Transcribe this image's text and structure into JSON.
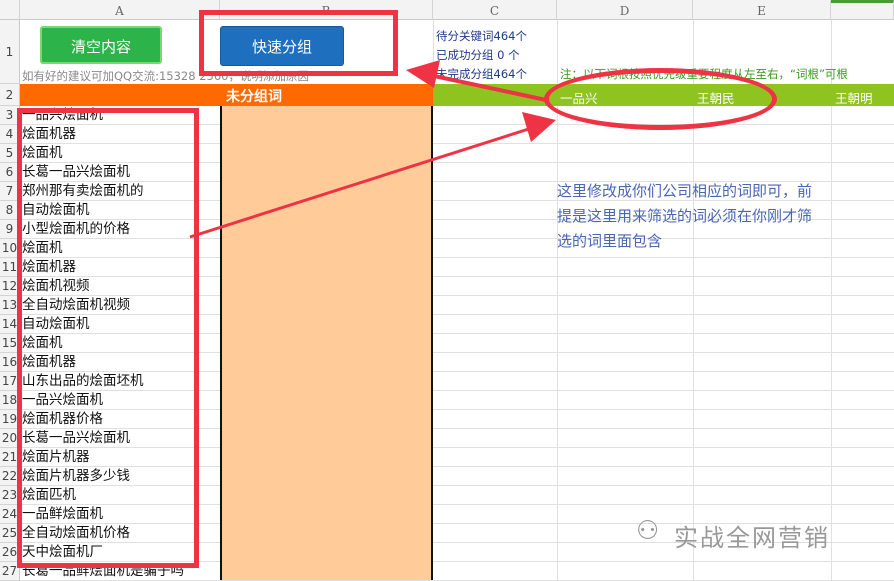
{
  "columns": [
    "A",
    "B",
    "C",
    "D",
    "E"
  ],
  "rows": [
    "1",
    "2",
    "3",
    "4",
    "5",
    "6",
    "7",
    "8",
    "9",
    "10",
    "11",
    "12",
    "13",
    "14",
    "15",
    "16",
    "17",
    "18",
    "19",
    "20",
    "21",
    "22",
    "23",
    "24",
    "25",
    "26",
    "27"
  ],
  "buttons": {
    "clear": "清空内容",
    "group": "快速分组"
  },
  "suggestion": "如有好的建议可加QQ交流:15328  2560，说明添加原因",
  "stats": {
    "pending": "待分关键词464个",
    "done": "已成功分组 0 个",
    "undone": "未完成分组464个"
  },
  "note": "注：以下词根按照优先级重要程度从左至右，“词根”可根",
  "header_row": {
    "ungrouped": "未分组词",
    "kw1": "一品兴",
    "kw2": "王朝民",
    "kw3": "王朝明"
  },
  "keywords": [
    "一品兴烩面机",
    "烩面机器",
    "烩面机",
    "长葛一品兴烩面机",
    "郑州那有卖烩面机的",
    "自动烩面机",
    "小型烩面机的价格",
    "烩面机",
    "烩面机器",
    "烩面机视频",
    "全自动烩面机视频",
    "自动烩面机",
    "烩面机",
    "烩面机器",
    "山东出品的烩面坯机",
    "一品兴烩面机",
    "烩面机器价格",
    "长葛一品兴烩面机",
    "烩面片机器",
    "烩面片机器多少钱",
    "烩面匹机",
    "一品鲜烩面机",
    "全自动烩面机价格",
    "天中烩面机厂",
    "长葛一品鲜烩面机是骗子吗"
  ],
  "annotation": [
    "这里修改成你们公司相应的词即可，前",
    "提是这里用来筛选的词必须在你刚才筛",
    "选的词里面包含"
  ],
  "watermark": "实战全网营销",
  "colors": {
    "orange": "#ff6a00",
    "peach": "#ffcc99",
    "green": "#8fc31f",
    "red": "#ee3344",
    "blue_btn": "#1f6fbf",
    "green_btn": "#2cb34a"
  }
}
